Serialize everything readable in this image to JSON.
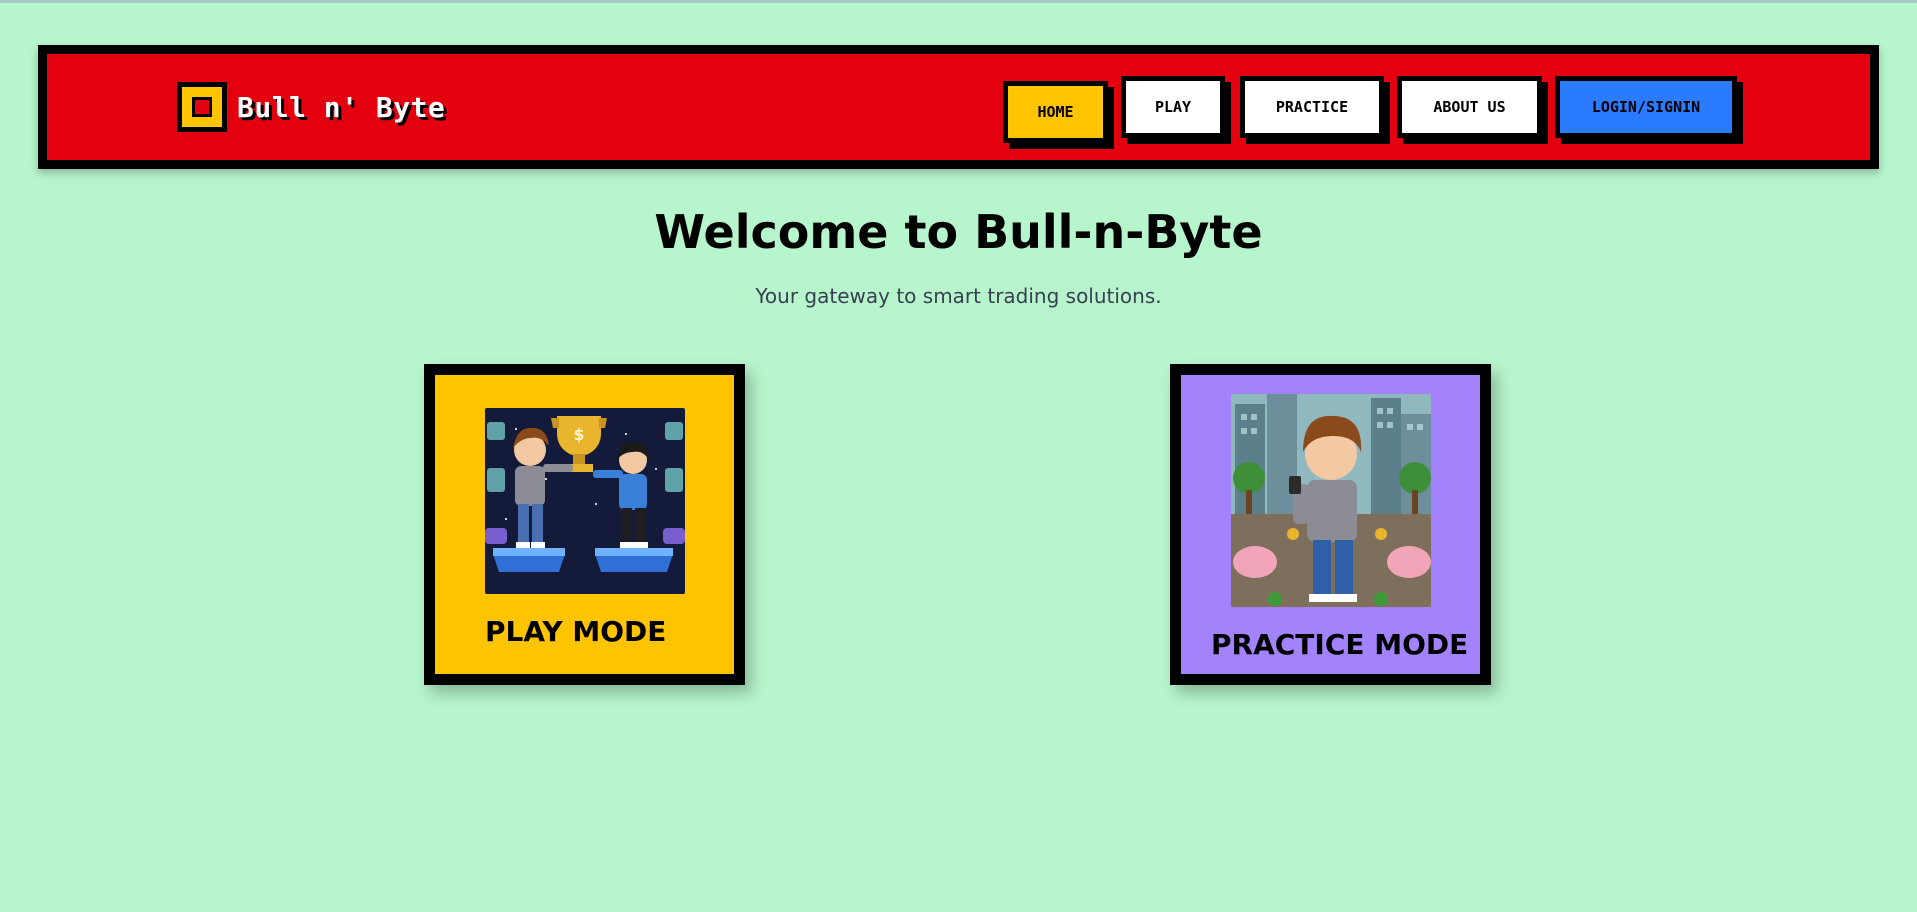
{
  "brand": {
    "name": "Bull n' Byte"
  },
  "nav": {
    "home": "HOME",
    "play": "PLAY",
    "practice": "PRACTICE",
    "about": "ABOUT US",
    "login": "LOGIN/SIGNIN"
  },
  "hero": {
    "title": "Welcome to Bull-n-Byte",
    "subtitle": "Your gateway to smart trading solutions."
  },
  "cards": {
    "play": {
      "label": "PLAY MODE",
      "image": "pixel-art-trophy-duo-illustration",
      "color": "#ffc400"
    },
    "practice": {
      "label": "PRACTICE MODE",
      "image": "pixel-art-investor-city-illustration",
      "color": "#a283fb"
    }
  },
  "colors": {
    "background": "#b7f5cc",
    "navbar": "#e3000f",
    "accent_yellow": "#ffc400",
    "accent_blue": "#2a7bff",
    "accent_purple": "#a283fb"
  }
}
